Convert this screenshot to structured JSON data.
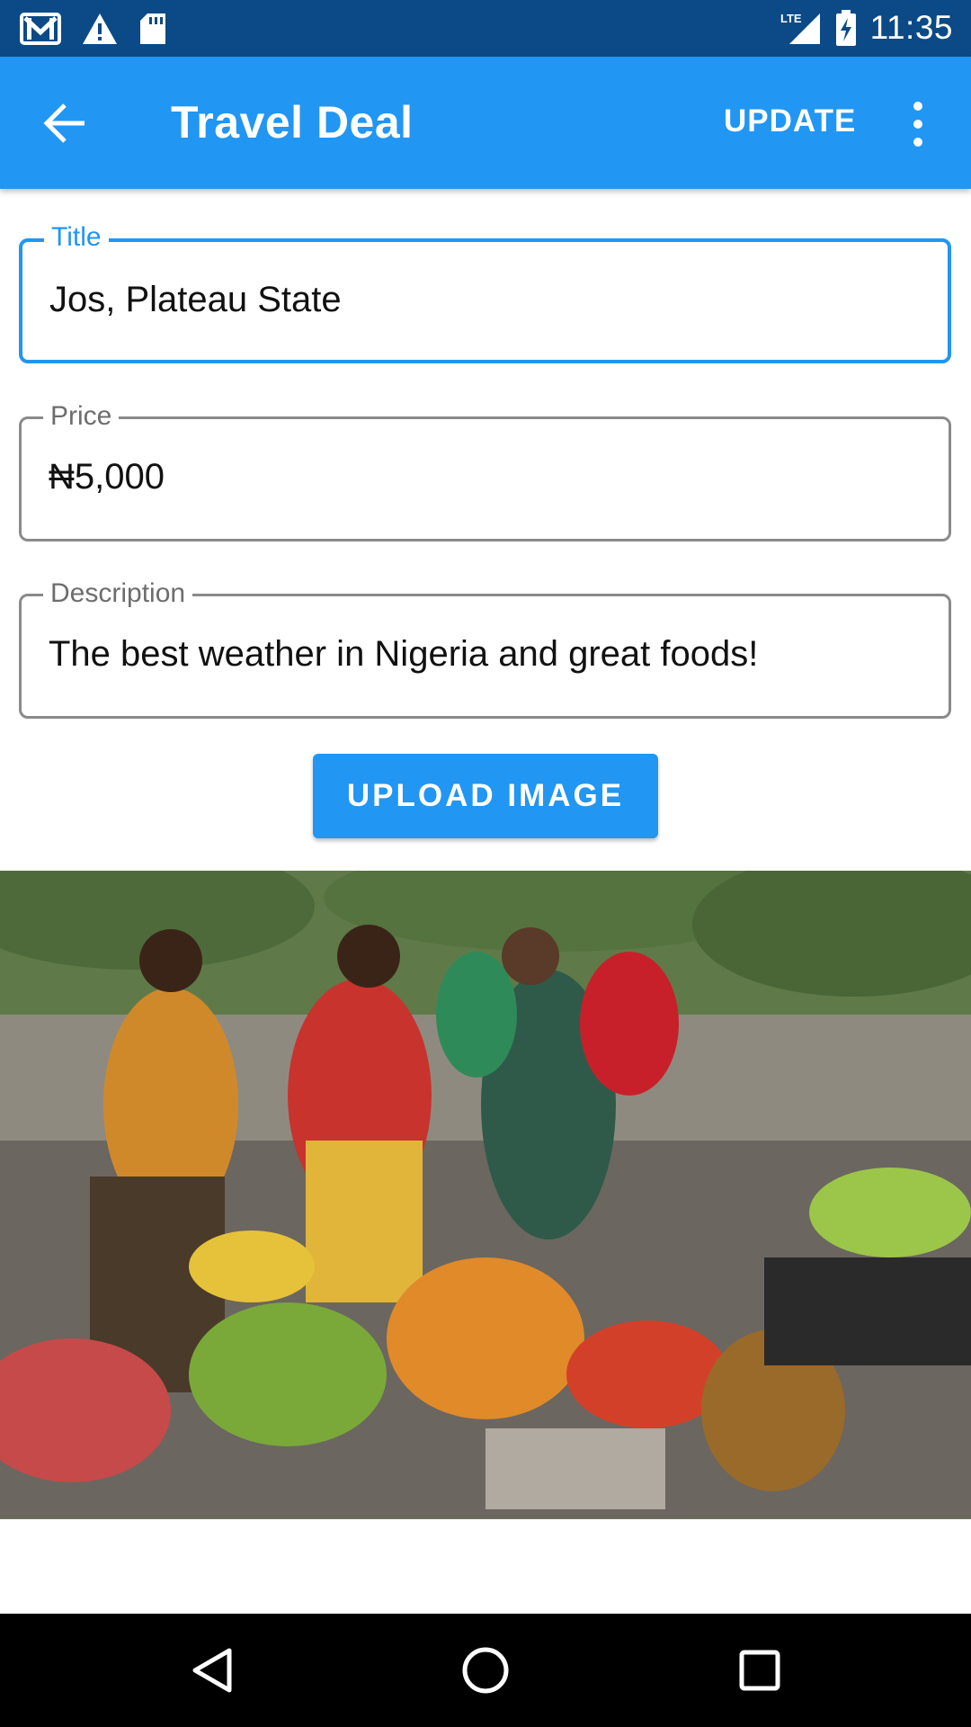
{
  "status_bar": {
    "time": "11:35",
    "network": "LTE",
    "icons": [
      "gmail-icon",
      "warning-icon",
      "sd-card-icon",
      "signal-icon",
      "battery-charging-icon"
    ]
  },
  "app_bar": {
    "title": "Travel Deal",
    "action_label": "UPDATE",
    "back_icon": "arrow-back-icon",
    "overflow_icon": "more-vert-icon"
  },
  "form": {
    "title": {
      "label": "Title",
      "value": "Jos, Plateau State"
    },
    "price": {
      "label": "Price",
      "value": "₦5,000"
    },
    "description": {
      "label": "Description",
      "value": "The best weather in Nigeria and great foods!"
    }
  },
  "upload_button": {
    "label": "UPLOAD IMAGE"
  },
  "colors": {
    "status_bar": "#0b4a86",
    "primary": "#2196f3",
    "field_border": "#8a8a8a",
    "nav_bar": "#000000"
  },
  "nav_bar": {
    "icons": [
      "back-triangle-icon",
      "home-circle-icon",
      "recents-square-icon"
    ]
  }
}
